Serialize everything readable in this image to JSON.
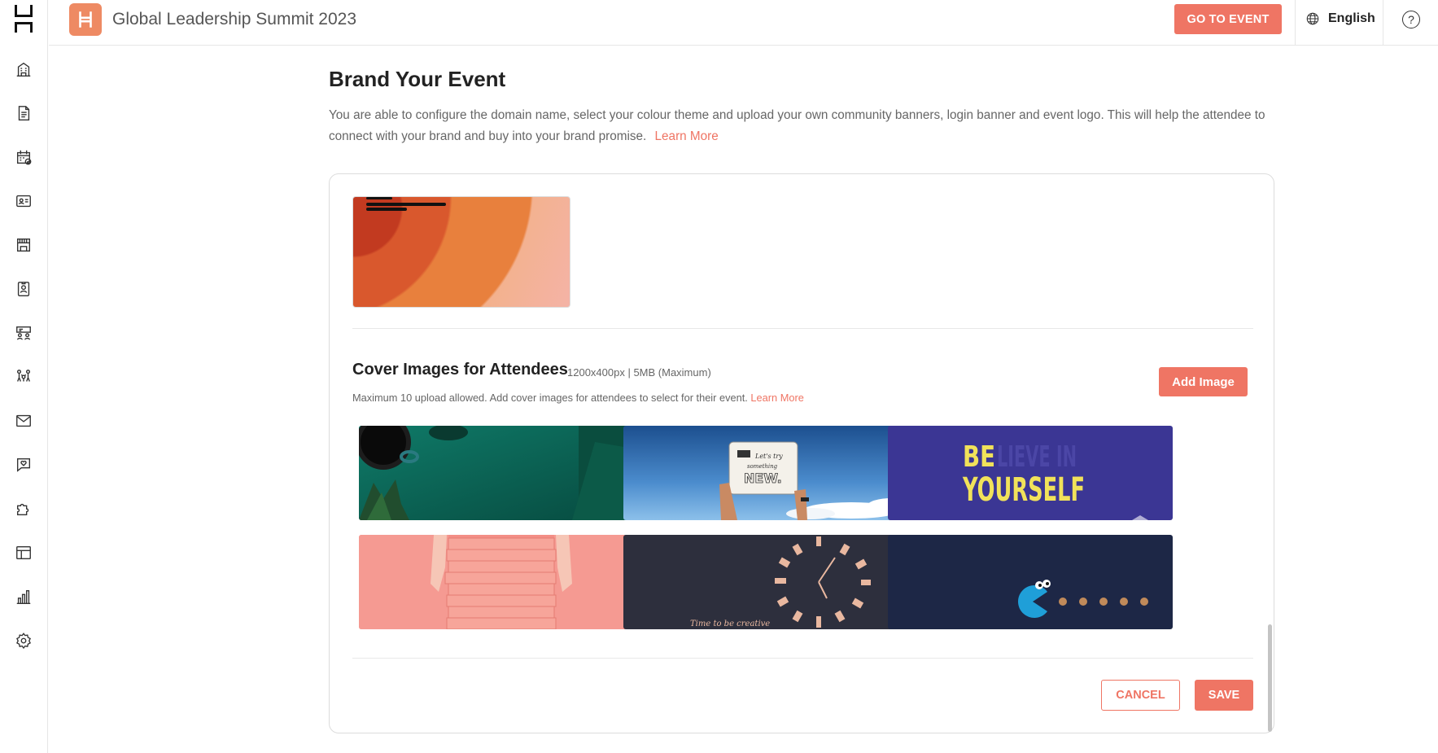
{
  "header": {
    "event_title": "Global Leadership Summit 2023",
    "go_to_event_label": "GO TO EVENT",
    "language": "English",
    "help_symbol": "?"
  },
  "sidebar": {
    "items": [
      {
        "icon": "building-icon"
      },
      {
        "icon": "document-icon"
      },
      {
        "icon": "calendar-check-icon"
      },
      {
        "icon": "id-card-icon"
      },
      {
        "icon": "booth-icon"
      },
      {
        "icon": "badge-icon"
      },
      {
        "icon": "meeting-icon"
      },
      {
        "icon": "networking-icon"
      },
      {
        "icon": "mail-icon"
      },
      {
        "icon": "chat-heart-icon"
      },
      {
        "icon": "puzzle-icon"
      },
      {
        "icon": "layout-icon"
      },
      {
        "icon": "analytics-icon"
      },
      {
        "icon": "settings-icon"
      }
    ]
  },
  "main": {
    "title": "Brand Your Event",
    "description": "You are able to configure the domain name, select your colour theme and upload your own community banners, login banner and event logo. This will help the attendee to connect with your brand and buy into your brand promise.",
    "learn_more": "Learn More"
  },
  "cover_images": {
    "title": "Cover Images for Attendees",
    "meta": "1200x400px | 5MB (Maximum)",
    "description": "Maximum 10 upload allowed. Add cover images for attendees to select for their event.",
    "learn_more": "Learn More",
    "add_label": "Add Image",
    "images": [
      {
        "name": "green-desk-coffee"
      },
      {
        "name": "lets-try-something-new",
        "caption": "Let's try something NEW."
      },
      {
        "name": "believe-in-yourself",
        "caption_bold": "BE",
        "caption_faded": "LIEVE IN",
        "caption_line2": "YOURSELF"
      },
      {
        "name": "pink-books-stack"
      },
      {
        "name": "dominoes-clock",
        "caption": "Time to be creative"
      },
      {
        "name": "pacman-cookies"
      }
    ]
  },
  "actions": {
    "cancel": "CANCEL",
    "save": "SAVE"
  },
  "colors": {
    "accent": "#ef7564",
    "badge": "#ee8a63"
  }
}
